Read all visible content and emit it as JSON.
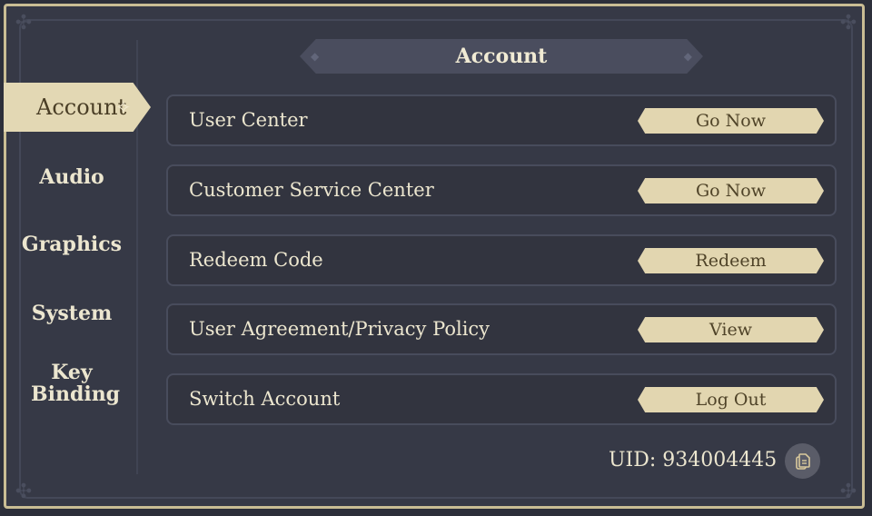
{
  "header": {
    "title": "Account"
  },
  "sidebar": {
    "tabs": [
      {
        "label": "Account",
        "active": true
      },
      {
        "label": "Audio",
        "active": false
      },
      {
        "label": "Graphics",
        "active": false
      },
      {
        "label": "System",
        "active": false
      },
      {
        "label": "Key Binding",
        "active": false
      }
    ]
  },
  "rows": [
    {
      "label": "User Center",
      "button": "Go Now"
    },
    {
      "label": "Customer Service Center",
      "button": "Go Now"
    },
    {
      "label": "Redeem Code",
      "button": "Redeem"
    },
    {
      "label": "User Agreement/Privacy Policy",
      "button": "View"
    },
    {
      "label": "Switch Account",
      "button": "Log Out"
    }
  ],
  "footer": {
    "uid": "UID: 934004445",
    "copy_icon": "copy-icon"
  },
  "colors": {
    "accent": "#e2d6b0",
    "background": "#363946",
    "frame": "#c9bd94",
    "text": "#ece6cf"
  }
}
